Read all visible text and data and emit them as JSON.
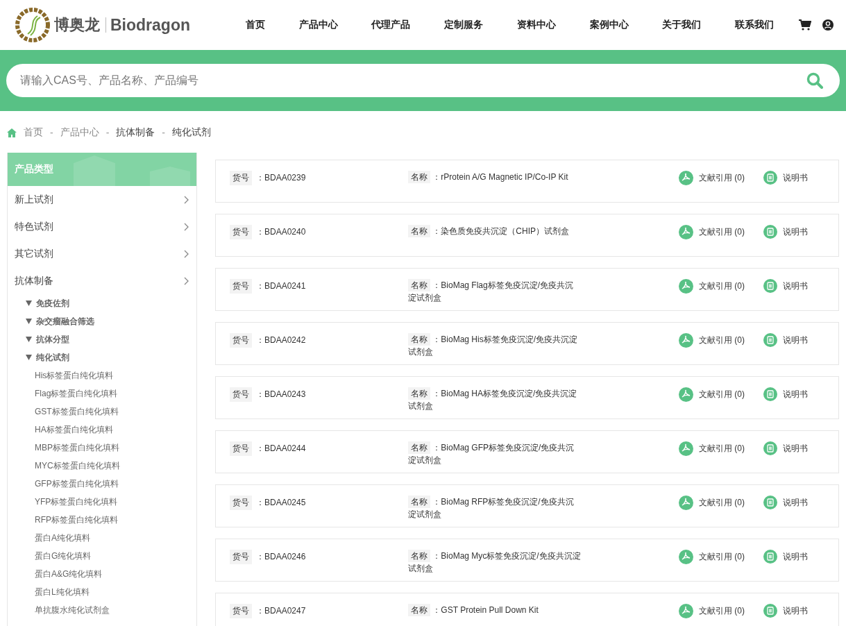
{
  "header": {
    "brand_cn": "博奥龙",
    "brand_en": "Biodragon",
    "nav": [
      "首页",
      "产品中心",
      "代理产品",
      "定制服务",
      "资料中心",
      "案例中心",
      "关于我们",
      "联系我们"
    ]
  },
  "search": {
    "placeholder": "请输入CAS号、产品名称、产品编号"
  },
  "breadcrumb": [
    {
      "kind": "link",
      "text": "首页"
    },
    {
      "kind": "sep",
      "text": "-"
    },
    {
      "kind": "link",
      "text": "产品中心"
    },
    {
      "kind": "sep",
      "text": "-"
    },
    {
      "kind": "current",
      "text": "抗体制备"
    },
    {
      "kind": "sep",
      "text": "-"
    },
    {
      "kind": "current",
      "text": "纯化试剂"
    }
  ],
  "sidebar": {
    "title": "产品类型",
    "items": [
      {
        "label": "新上试剂"
      },
      {
        "label": "特色试剂"
      },
      {
        "label": "其它试剂"
      },
      {
        "label": "抗体制备",
        "children": [
          {
            "label": "免疫佐剂"
          },
          {
            "label": "杂交瘤融合筛选"
          },
          {
            "label": "抗体分型"
          },
          {
            "label": "纯化试剂",
            "children": [
              {
                "label": "His标签蛋白纯化填料"
              },
              {
                "label": "Flag标签蛋白纯化填料"
              },
              {
                "label": "GST标签蛋白纯化填料"
              },
              {
                "label": "HA标签蛋白纯化填料"
              },
              {
                "label": "MBP标签蛋白纯化填料"
              },
              {
                "label": "MYC标签蛋白纯化填料"
              },
              {
                "label": "GFP标签蛋白纯化填料"
              },
              {
                "label": "YFP标签蛋白纯化填料"
              },
              {
                "label": "RFP标签蛋白纯化填料"
              },
              {
                "label": "蛋白A纯化填料"
              },
              {
                "label": "蛋白G纯化填料"
              },
              {
                "label": "蛋白A&G纯化填料"
              },
              {
                "label": "蛋白L纯化填料"
              },
              {
                "label": "单抗腹水纯化试剂盒"
              }
            ]
          }
        ]
      }
    ]
  },
  "products": [
    {
      "code_label": "货号",
      "code": "：BDAA0239",
      "name_label": "名称",
      "name": "：rProtein A/G Magnetic IP/Co-IP Kit",
      "citations": "文献引用 (0)",
      "manual": "说明书"
    },
    {
      "code_label": "货号",
      "code": "：BDAA0240",
      "name_label": "名称",
      "name": "：染色质免疫共沉淀（CHIP）试剂盒",
      "citations": "文献引用 (0)",
      "manual": "说明书"
    },
    {
      "code_label": "货号",
      "code": "：BDAA0241",
      "name_label": "名称",
      "name": "：BioMag Flag标签免疫沉淀/免疫共沉淀试剂盒",
      "citations": "文献引用 (0)",
      "manual": "说明书"
    },
    {
      "code_label": "货号",
      "code": "：BDAA0242",
      "name_label": "名称",
      "name": "：BioMag His标签免疫沉淀/免疫共沉淀试剂盒",
      "citations": "文献引用 (0)",
      "manual": "说明书"
    },
    {
      "code_label": "货号",
      "code": "：BDAA0243",
      "name_label": "名称",
      "name": "：BioMag HA标签免疫沉淀/免疫共沉淀试剂盒",
      "citations": "文献引用 (0)",
      "manual": "说明书"
    },
    {
      "code_label": "货号",
      "code": "：BDAA0244",
      "name_label": "名称",
      "name": "：BioMag GFP标签免疫沉淀/免疫共沉淀试剂盒",
      "citations": "文献引用 (0)",
      "manual": "说明书"
    },
    {
      "code_label": "货号",
      "code": "：BDAA0245",
      "name_label": "名称",
      "name": "：BioMag RFP标签免疫沉淀/免疫共沉淀试剂盒",
      "citations": "文献引用 (0)",
      "manual": "说明书"
    },
    {
      "code_label": "货号",
      "code": "：BDAA0246",
      "name_label": "名称",
      "name": "：BioMag Myc标签免疫沉淀/免疫共沉淀试剂盒",
      "citations": "文献引用 (0)",
      "manual": "说明书"
    },
    {
      "code_label": "货号",
      "code": "：BDAA0247",
      "name_label": "名称",
      "name": "：GST Protein Pull Down Kit",
      "citations": "文献引用 (0)",
      "manual": "说明书"
    }
  ]
}
